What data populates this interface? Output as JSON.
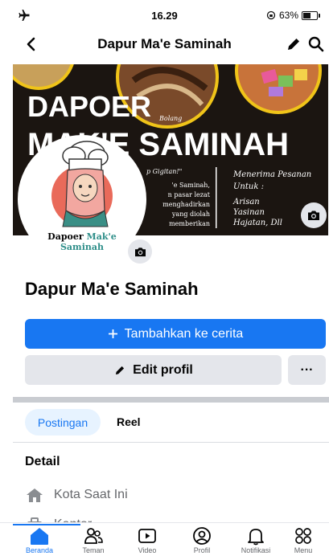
{
  "status_bar": {
    "time": "16.29",
    "battery": "63%",
    "battery_level": 0.63
  },
  "header": {
    "title": "Dapur Ma'e Saminah"
  },
  "cover": {
    "headline_line1": "DAPOER",
    "headline_line2": "MAK'E SAMINAH",
    "tagline": "p Gigitan!\"",
    "food_label": "Bolang",
    "desc_lines": [
      "'e Saminah,",
      "n pasar lezat",
      "menghadirkan",
      "yang diolah",
      "memberikan"
    ],
    "order_title_1": "Menerima Pesanan",
    "order_title_2": "Untuk :",
    "order_items": [
      "Arisan",
      "Yasinan",
      "Hajatan, Dll"
    ]
  },
  "avatar": {
    "logo_word1": "Dapoer",
    "logo_word2": "Mak'e",
    "logo_word3": "Saminah"
  },
  "profile": {
    "name": "Dapur Ma'e Saminah",
    "add_story_label": "Tambahkan ke cerita",
    "edit_profile_label": "Edit profil",
    "more_label": "···"
  },
  "tabs": [
    {
      "label": "Postingan",
      "active": true
    },
    {
      "label": "Reel",
      "active": false
    }
  ],
  "details": {
    "heading": "Detail",
    "items": [
      {
        "label": "Kota Saat Ini",
        "icon": "house-icon"
      },
      {
        "label": "Kantor",
        "icon": "briefcase-icon"
      }
    ]
  },
  "bottom_nav": [
    {
      "label": "Beranda",
      "icon": "home-icon",
      "active": true
    },
    {
      "label": "Teman",
      "icon": "friends-icon",
      "active": false
    },
    {
      "label": "Video",
      "icon": "video-icon",
      "active": false
    },
    {
      "label": "Profil",
      "icon": "profile-icon",
      "active": false
    },
    {
      "label": "Notifikasi",
      "icon": "bell-icon",
      "active": false
    },
    {
      "label": "Menu",
      "icon": "menu-grid-icon",
      "active": false
    }
  ],
  "colors": {
    "primary": "#1877f2",
    "secondary_bg": "#e4e6eb",
    "text": "#050505",
    "muted": "#65676b"
  }
}
